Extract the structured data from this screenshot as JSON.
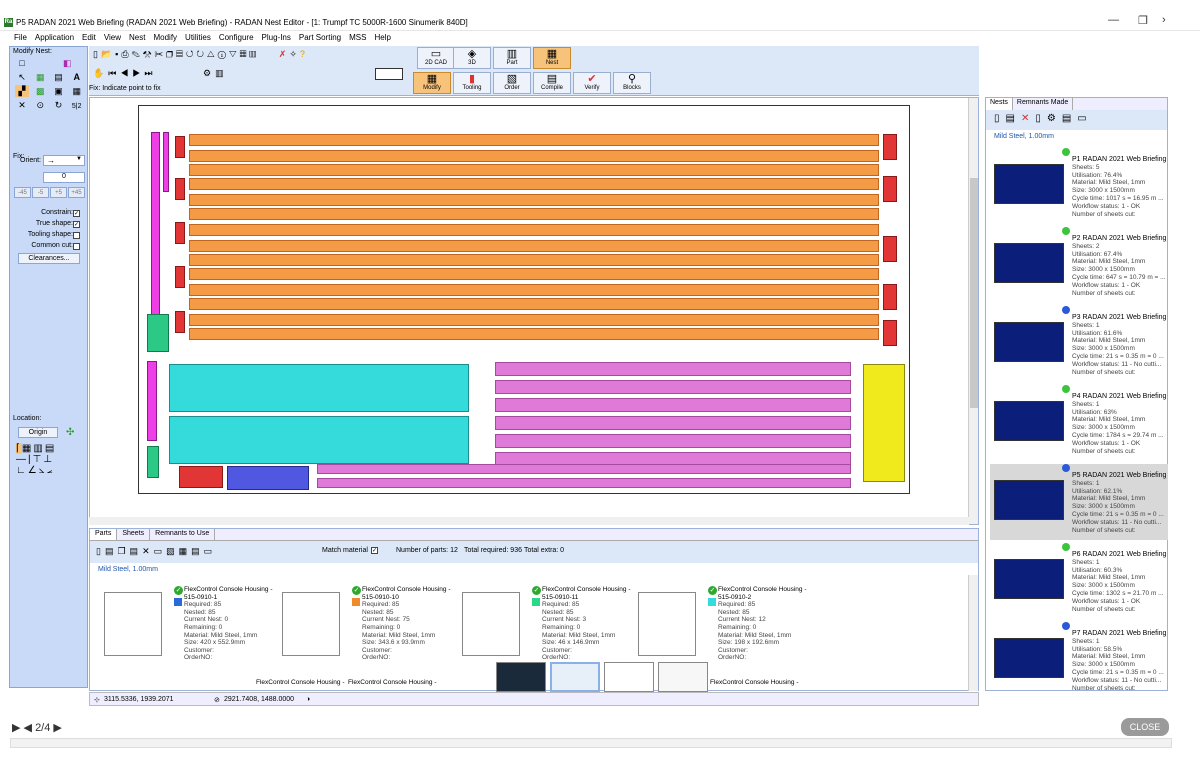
{
  "window": {
    "title": "P5 RADAN 2021 Web Briefing (RADAN 2021 Web Briefing) - RADAN Nest Editor - [1: Trumpf TC 5000R-1600 Sinumerik 840D]",
    "app_icon": "Ra"
  },
  "menu": [
    "File",
    "Application",
    "Edit",
    "View",
    "Nest",
    "Modify",
    "Utilities",
    "Configure",
    "Plug-Ins",
    "Part Sorting",
    "MSS",
    "Help"
  ],
  "left": {
    "modify_nest_label": "Modify Nest:",
    "fix_label": "Fix:",
    "orient_label": "Orient:",
    "orient_value": "→",
    "angle_value": "0",
    "angle_buttons": [
      "-45",
      "-5",
      "+5",
      "+45"
    ],
    "constrain_label": "Constrain:",
    "true_shape_label": "True shape:",
    "tooling_shape_label": "Tooling shape:",
    "common_cut_label": "Common cut:",
    "clearances_label": "Clearances...",
    "location_label": "Location:",
    "origin_label": "Origin"
  },
  "toolbar": {
    "big_buttons_top": [
      "2D CAD",
      "3D",
      "Part",
      "Nest"
    ],
    "big_buttons_bottom": [
      "Modify",
      "Tooling",
      "Order",
      "Compile",
      "Verify",
      "Blocks"
    ],
    "active_top": "Nest",
    "active_bottom": "Modify",
    "status_text": "Fix: Indicate point to fix"
  },
  "right": {
    "tabs": [
      "Nests",
      "Remnants Made"
    ],
    "material": "Mild Steel, 1.00mm",
    "nests": [
      {
        "title": "P1 RADAN 2021 Web Briefing",
        "lines": [
          "Sheets: 5",
          "Utilisation: 76.4%",
          "Material: Mild Steel, 1mm",
          "Size: 3000 x 1500mm",
          "Cycle time: 1017 s = 16.95 m ...",
          "Workflow status: 1 - OK",
          "Number of sheets cut:"
        ],
        "status_color": "#3cc43c"
      },
      {
        "title": "P2 RADAN 2021 Web Briefing",
        "lines": [
          "Sheets: 2",
          "Utilisation: 67.4%",
          "Material: Mild Steel, 1mm",
          "Size: 3000 x 1500mm",
          "Cycle time: 647 s = 10.79 m = ...",
          "Workflow status: 1 - OK",
          "Number of sheets cut:"
        ],
        "status_color": "#3cc43c"
      },
      {
        "title": "P3 RADAN 2021 Web Briefing",
        "lines": [
          "Sheets: 1",
          "Utilisation: 61.6%",
          "Material: Mild Steel, 1mm",
          "Size: 3000 x 1500mm",
          "Cycle time: 21 s = 0.35 m = 0 ...",
          "Workflow status: 11 - No cutti...",
          "Number of sheets cut:"
        ],
        "status_color": "#2a5ad8"
      },
      {
        "title": "P4 RADAN 2021 Web Briefing",
        "lines": [
          "Sheets: 1",
          "Utilisation: 63%",
          "Material: Mild Steel, 1mm",
          "Size: 3000 x 1500mm",
          "Cycle time: 1784 s = 29.74 m ...",
          "Workflow status: 1 - OK",
          "Number of sheets cut:"
        ],
        "status_color": "#3cc43c"
      },
      {
        "title": "P5 RADAN 2021 Web Briefing",
        "lines": [
          "Sheets: 1",
          "Utilisation: 62.1%",
          "Material: Mild Steel, 1mm",
          "Size: 3000 x 1500mm",
          "Cycle time: 21 s = 0.35 m = 0 ...",
          "Workflow status: 11 - No cutti...",
          "Number of sheets cut:"
        ],
        "status_color": "#2a5ad8"
      },
      {
        "title": "P6 RADAN 2021 Web Briefing",
        "lines": [
          "Sheets: 1",
          "Utilisation: 60.3%",
          "Material: Mild Steel, 1mm",
          "Size: 3000 x 1500mm",
          "Cycle time: 1302 s = 21.70 m ...",
          "Workflow status: 1 - OK",
          "Number of sheets cut:"
        ],
        "status_color": "#3cc43c"
      },
      {
        "title": "P7 RADAN 2021 Web Briefing",
        "lines": [
          "Sheets: 1",
          "Utilisation: 58.5%",
          "Material: Mild Steel, 1mm",
          "Size: 3000 x 1500mm",
          "Cycle time: 21 s = 0.35 m = 0 ...",
          "Workflow status: 11 - No cutti...",
          "Number of sheets cut:"
        ],
        "status_color": "#2a5ad8"
      }
    ]
  },
  "bottom": {
    "tabs": [
      "Parts",
      "Sheets",
      "Remnants to Use"
    ],
    "match_material_label": "Match material",
    "num_parts": "Number of parts: 12",
    "total_required": "Total required: 936",
    "total_extra": "Total extra: 0",
    "material": "Mild Steel, 1.00mm",
    "parts": [
      {
        "name": "FlexControl Console Housing - 515-0910-1",
        "lines": [
          "Required: 85",
          "Nested: 85",
          "Current Nest: 0",
          "Remaining: 0",
          "Material: Mild Steel, 1mm",
          "Size: 420 x 552.9mm",
          "Customer:",
          "OrderNO:"
        ],
        "color": "#2a6ad8"
      },
      {
        "name": "FlexControl Console Housing - 515-0910-10",
        "lines": [
          "Required: 85",
          "Nested: 85",
          "Current Nest: 75",
          "Remaining: 0",
          "Material: Mild Steel, 1mm",
          "Size: 343.6 x 93.9mm",
          "Customer:",
          "OrderNO:"
        ],
        "color": "#f08a2a"
      },
      {
        "name": "FlexControl Console Housing - 515-0910-11",
        "lines": [
          "Required: 85",
          "Nested: 85",
          "Current Nest: 3",
          "Remaining: 0",
          "Material: Mild Steel, 1mm",
          "Size: 46 x 146.9mm",
          "Customer:",
          "OrderNO:"
        ],
        "color": "#2bd88a"
      },
      {
        "name": "FlexControl Console Housing - 515-0910-2",
        "lines": [
          "Required: 85",
          "Nested: 85",
          "Current Nest: 12",
          "Remaining: 0",
          "Material: Mild Steel, 1mm",
          "Size: 198 x 192.6mm",
          "Customer:",
          "OrderNO:"
        ],
        "color": "#35dada"
      }
    ],
    "more_part_label": "FlexControl Console Housing -"
  },
  "coords": {
    "pos1": "3115.5336, 1939.2071",
    "pos2": "2921.7408, 1488.0000"
  },
  "viewer": {
    "page": "2/4",
    "close": "CLOSE"
  }
}
